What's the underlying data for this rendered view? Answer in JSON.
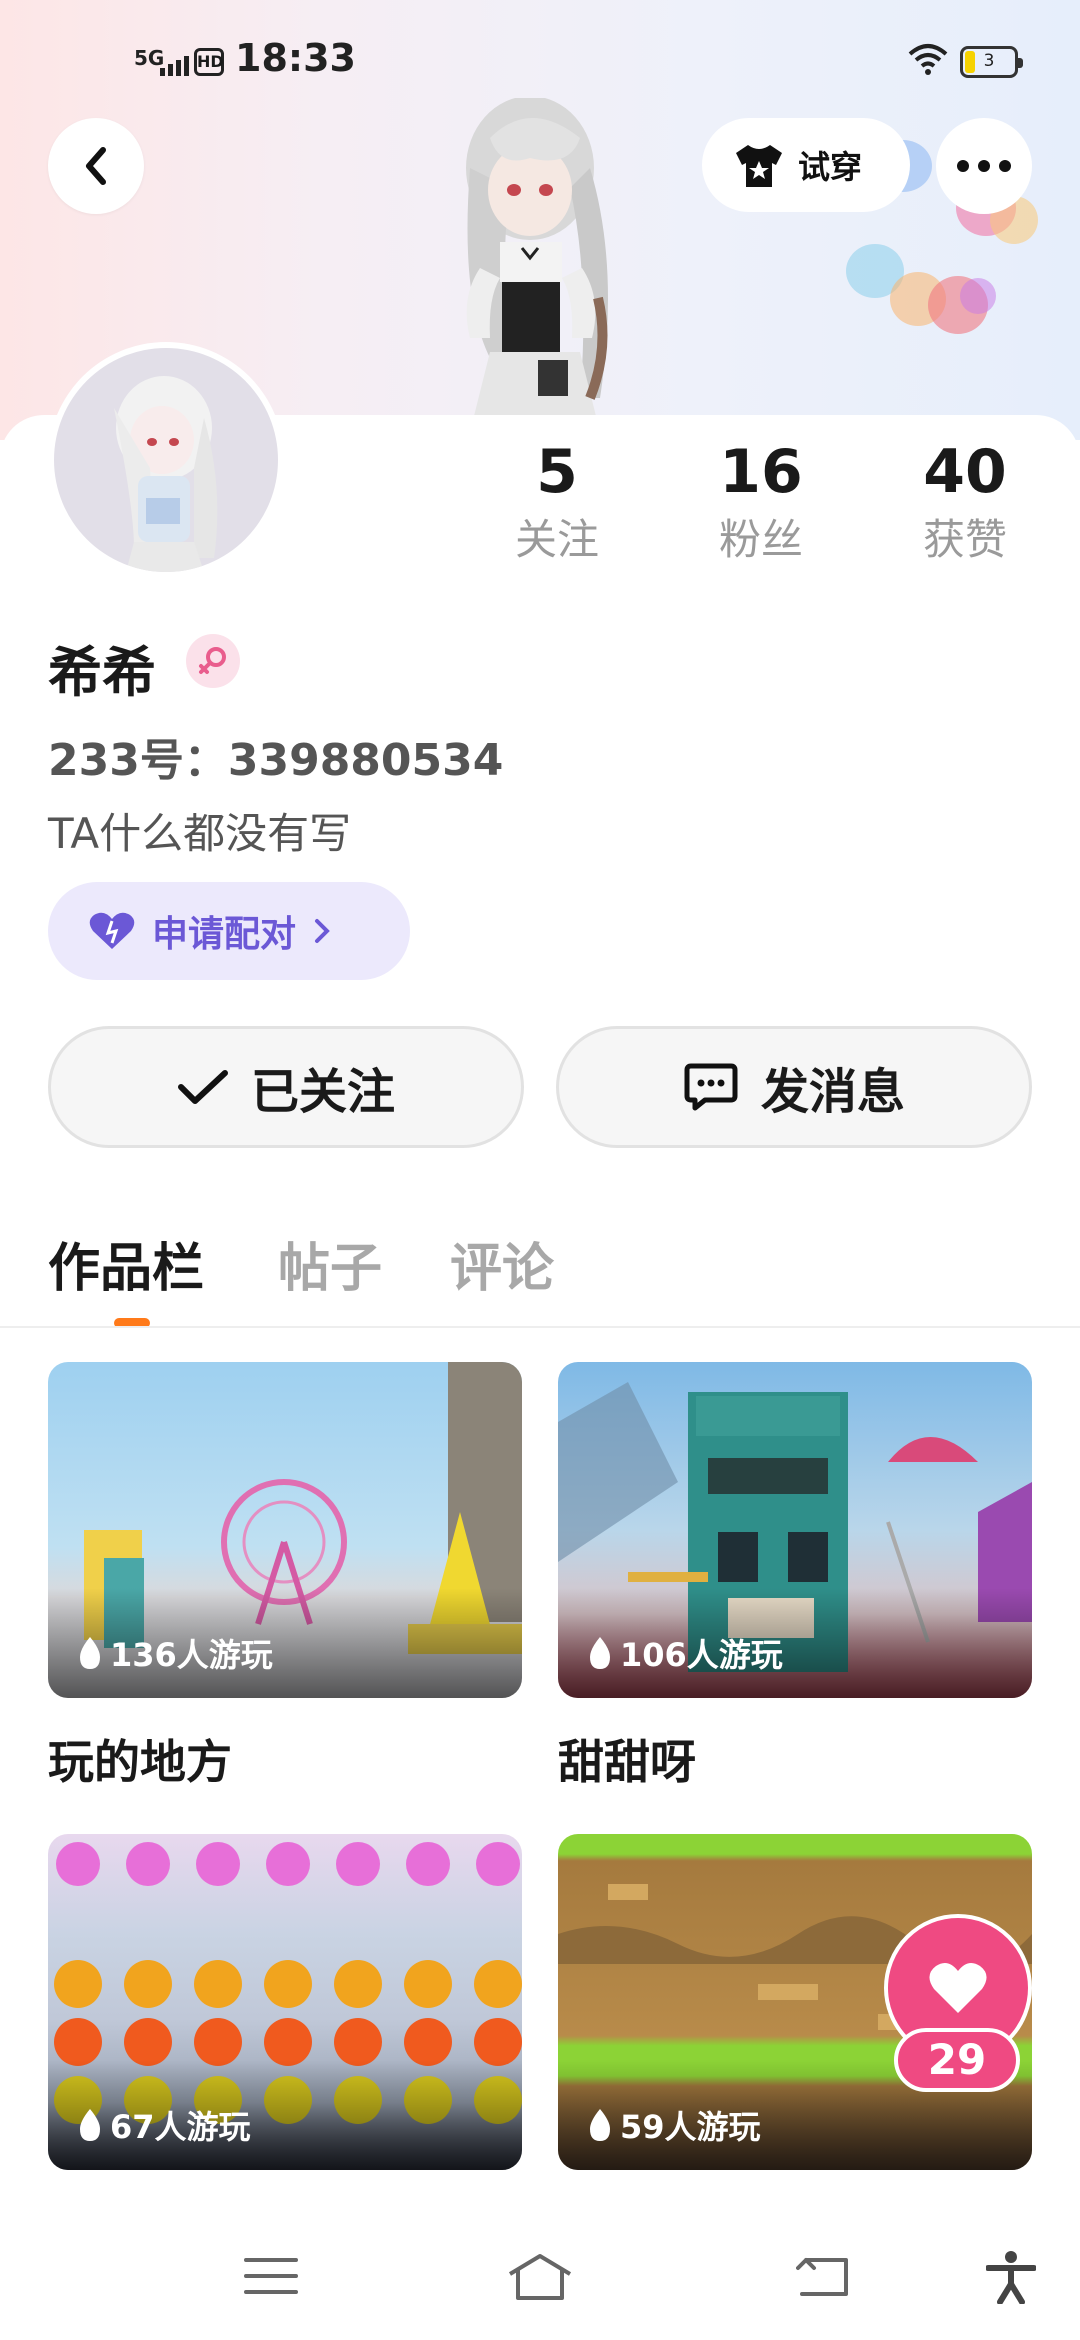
{
  "status_bar": {
    "network": "5G",
    "hd": "HD",
    "time": "18:33",
    "battery": "3"
  },
  "header": {
    "tryon_label": "试穿"
  },
  "stats": [
    {
      "value": "5",
      "label": "关注"
    },
    {
      "value": "16",
      "label": "粉丝"
    },
    {
      "value": "40",
      "label": "获赞"
    }
  ],
  "profile": {
    "name": "希希",
    "uid": "233号：339880534",
    "bio": "TA什么都没有写",
    "pair_label": "申请配对"
  },
  "actions": {
    "follow_label": "已关注",
    "message_label": "发消息"
  },
  "tabs": [
    {
      "label": "作品栏",
      "active": true
    },
    {
      "label": "帖子",
      "active": false
    },
    {
      "label": "评论",
      "active": false
    }
  ],
  "works": [
    {
      "title": "玩的地方",
      "plays": "136人游玩"
    },
    {
      "title": "甜甜呀",
      "plays": "106人游玩"
    },
    {
      "title": "",
      "plays": "67人游玩"
    },
    {
      "title": "",
      "plays": "59人游玩"
    }
  ],
  "floating_like": {
    "count": "29"
  },
  "colors": {
    "accent": "#ff7a1a",
    "pair": "#6b58d6",
    "like": "#ef4a82"
  },
  "icons": [
    "back-icon",
    "tshirt-icon",
    "more-icon",
    "female-icon",
    "heart-icon",
    "check-icon",
    "chat-icon",
    "flame-icon",
    "menu-icon",
    "home-icon",
    "return-icon",
    "accessibility-icon"
  ]
}
